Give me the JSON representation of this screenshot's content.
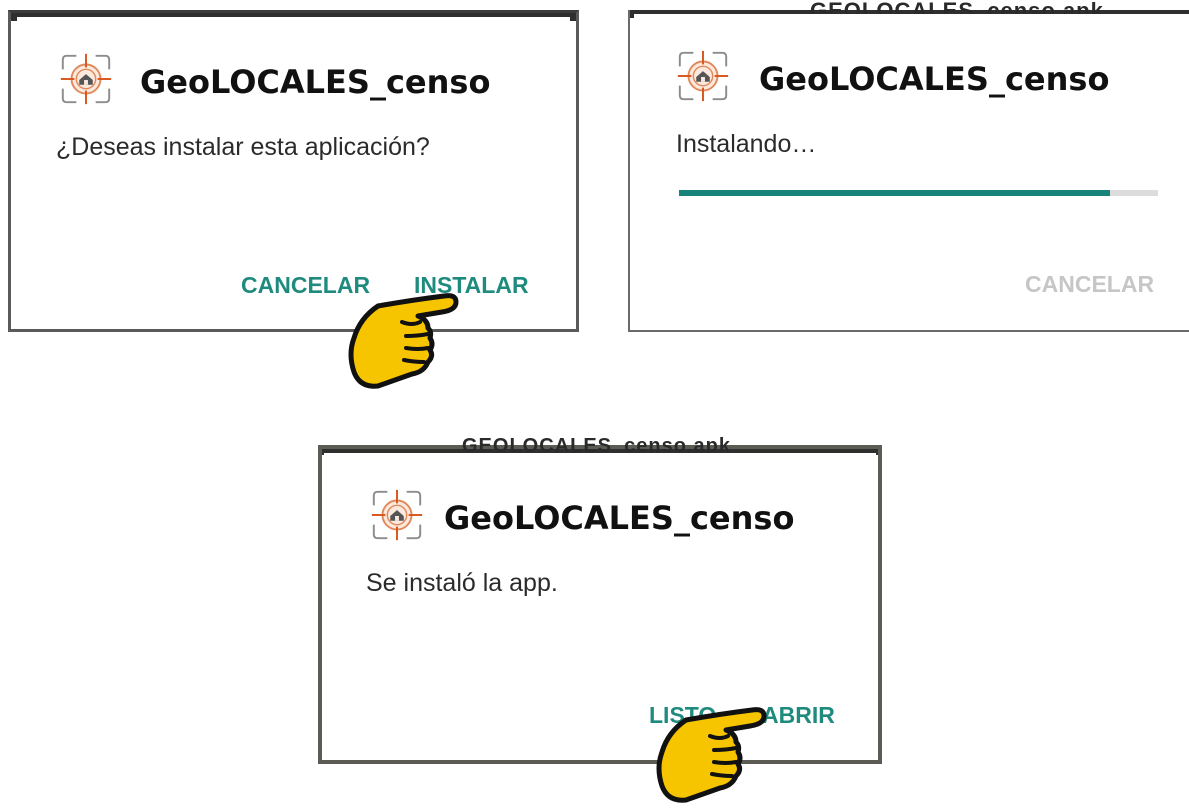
{
  "app": {
    "name": "GeoLOCALES_censo",
    "icon": "app-crosshair-house-icon"
  },
  "background_strip_text": [
    "GEOLOCALES_censo.apk",
    "GEOLOCALES_censo.apk"
  ],
  "install_prompt": {
    "message": "¿Deseas instalar esta aplicación?",
    "cancel_label": "CANCELAR",
    "install_label": "INSTALAR"
  },
  "installing": {
    "message": "Instalando…",
    "progress": 0.9,
    "cancel_label": "CANCELAR"
  },
  "installed": {
    "message": "Se instaló la app.",
    "done_label": "LISTO",
    "open_label": "ABRIR"
  },
  "colors": {
    "accent": "#1e8b7e",
    "progress": "#16847a",
    "disabled": "#c6c6c6",
    "pointer_hand": "#f7c500"
  },
  "pointer_icon": "pointing-hand-icon"
}
